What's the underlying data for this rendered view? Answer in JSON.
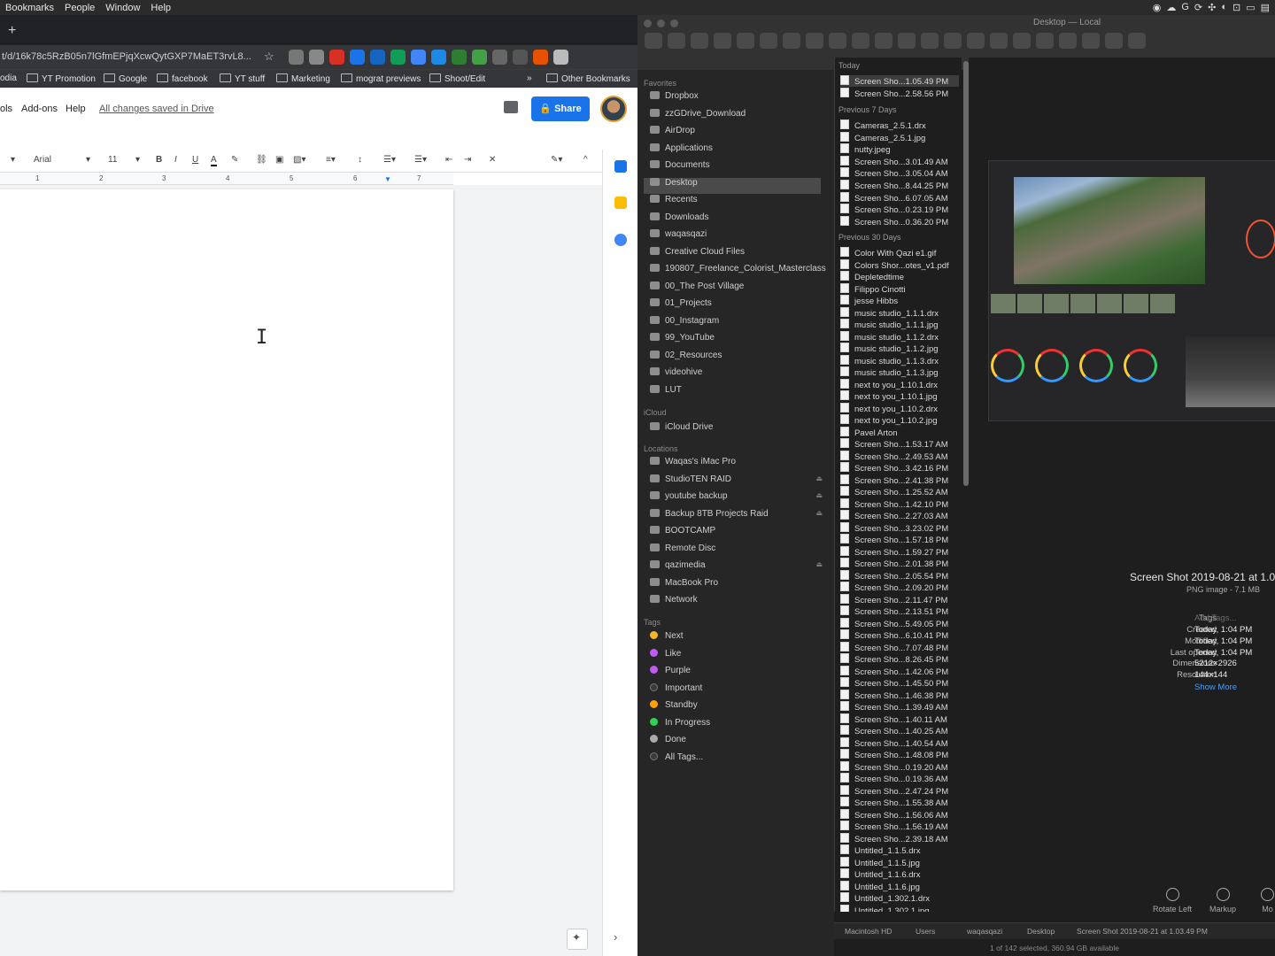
{
  "menubar": {
    "items": [
      "Bookmarks",
      "People",
      "Window",
      "Help"
    ],
    "tray": [
      "◉",
      "☁",
      "G",
      "⟳",
      "✣",
      "◐",
      "⊡",
      "▭",
      "▤"
    ]
  },
  "chrome": {
    "newtab": "+",
    "url": "t/d/16k78c5RzB05n7lGfmEPjqXcwQytGXP7MaET3rvL8...",
    "star": "☆",
    "bookmarks": [
      "odia",
      "YT Promotion",
      "Google",
      "facebook",
      "YT stuff",
      "Marketing",
      "mograt previews",
      "Shoot/Edit",
      "»",
      "Other Bookmarks"
    ]
  },
  "docs": {
    "menus": [
      "ols",
      "Add-ons",
      "Help"
    ],
    "saved": "All changes saved in Drive",
    "share": "Share",
    "font": "Arial",
    "size": "11",
    "ruler": [
      "1",
      "2",
      "3",
      "4",
      "5",
      "6",
      "7"
    ],
    "cursor": "I",
    "chev": "›"
  },
  "finder": {
    "title": "Desktop — Local",
    "favorites_header": "Favorites",
    "favorites": [
      "Dropbox",
      "zzGDrive_Download",
      "AirDrop",
      "Applications",
      "Documents",
      "Desktop",
      "Recents",
      "Downloads",
      "waqasqazi",
      "Creative Cloud Files",
      "190807_Freelance_Colorist_Masterclass",
      "00_The Post Village",
      "01_Projects",
      "00_Instagram",
      "99_YouTube",
      "02_Resources",
      "videohive",
      "LUT"
    ],
    "icloud_header": "iCloud",
    "icloud": [
      "iCloud Drive"
    ],
    "locations_header": "Locations",
    "locations": [
      "Waqas's iMac Pro",
      "StudioTEN RAID",
      "youtube backup",
      "Backup 8TB Projects Raid",
      "BOOTCAMP",
      "Remote Disc",
      "qazimedia",
      "MacBook Pro",
      "Network"
    ],
    "tags_header": "Tags",
    "tags": [
      {
        "name": "Next",
        "color": "#f5b52a"
      },
      {
        "name": "Like",
        "color": "#bf5af2"
      },
      {
        "name": "Purple",
        "color": "#bf5af2"
      },
      {
        "name": "Important",
        "color": "#3a3a3a"
      },
      {
        "name": "Standby",
        "color": "#ff9f0a"
      },
      {
        "name": "In Progress",
        "color": "#30d158"
      },
      {
        "name": "Done",
        "color": "#aaaaaa"
      },
      {
        "name": "All Tags...",
        "color": "#3a3a3a"
      }
    ],
    "today_header": "Today",
    "today": [
      "Screen Sho...1.05.49 PM",
      "Screen Sho...2.58.56 PM"
    ],
    "prev7_header": "Previous 7 Days",
    "prev7": [
      "Cameras_2.5.1.drx",
      "Cameras_2.5.1.jpg",
      "nutty.jpeg",
      "Screen Sho...3.01.49 AM",
      "Screen Sho...3.05.04 AM",
      "Screen Sho...8.44.25 PM",
      "Screen Sho...6.07.05 AM",
      "Screen Sho...0.23.19 PM",
      "Screen Sho...0.36.20 PM"
    ],
    "prev30_header": "Previous 30 Days",
    "prev30": [
      "Color With Qazi e1.gif",
      "Colors Shor...otes_v1.pdf",
      "Depletedtime",
      "Filippo Cinotti",
      "jesse Hibbs",
      "music studio_1.1.1.drx",
      "music studio_1.1.1.jpg",
      "music studio_1.1.2.drx",
      "music studio_1.1.2.jpg",
      "music studio_1.1.3.drx",
      "music studio_1.1.3.jpg",
      "next to you_1.10.1.drx",
      "next to you_1.10.1.jpg",
      "next to you_1.10.2.drx",
      "next to you_1.10.2.jpg",
      "Pavel Arton",
      "Screen Sho...1.53.17 AM",
      "Screen Sho...2.49.53 AM",
      "Screen Sho...3.42.16 PM",
      "Screen Sho...2.41.38 PM",
      "Screen Sho...1.25.52 AM",
      "Screen Sho...1.42.10 PM",
      "Screen Sho...2.27.03 AM",
      "Screen Sho...3.23.02 PM",
      "Screen Sho...1.57.18 PM",
      "Screen Sho...1.59.27 PM",
      "Screen Sho...2.01.38 PM",
      "Screen Sho...2.05.54 PM",
      "Screen Sho...2.09.20 PM",
      "Screen Sho...2.11.47 PM",
      "Screen Sho...2.13.51 PM",
      "Screen Sho...5.49.05 PM",
      "Screen Sho...6.10.41 PM",
      "Screen Sho...7.07.48 PM",
      "Screen Sho...8.26.45 PM",
      "Screen Sho...1.42.06 PM",
      "Screen Sho...1.45.50 PM",
      "Screen Sho...1.46.38 PM",
      "Screen Sho...1.39.49 AM",
      "Screen Sho...1.40.11 AM",
      "Screen Sho...1.40.25 AM",
      "Screen Sho...1.40.54 AM",
      "Screen Sho...1.48.08 PM",
      "Screen Sho...0.19.20 AM",
      "Screen Sho...0.19.36 AM",
      "Screen Sho...2.47.24 PM",
      "Screen Sho...1.55.38 AM",
      "Screen Sho...1.56.06 AM",
      "Screen Sho...1.56.19 AM",
      "Screen Sho...2.39.18 AM",
      "Untitled_1.1.5.drx",
      "Untitled_1.1.5.jpg",
      "Untitled_1.1.6.drx",
      "Untitled_1.1.6.jpg",
      "Untitled_1.302.1.drx",
      "Untitled_1.302.1.jpg"
    ],
    "preview": {
      "name": "Screen Shot 2019-08-21 at 1.0",
      "kind": "PNG image - 7.1 MB",
      "tags_label": "Tags",
      "tags_placeholder": "Add Tags...",
      "meta": [
        {
          "k": "Created",
          "v": "Today, 1:04 PM"
        },
        {
          "k": "Modified",
          "v": "Today, 1:04 PM"
        },
        {
          "k": "Last opened",
          "v": "Today, 1:04 PM"
        },
        {
          "k": "Dimensions",
          "v": "5212×2926"
        },
        {
          "k": "Resolution",
          "v": "144×144"
        }
      ],
      "show_more": "Show More",
      "rotate": "Rotate Left",
      "markup": "Markup",
      "more": "Mo"
    },
    "path": [
      "Macintosh HD",
      "Users",
      "waqasqazi",
      "Desktop",
      "Screen Shot 2019-08-21 at 1.03.49 PM"
    ],
    "status": "1 of 142 selected, 360.94 GB available"
  }
}
